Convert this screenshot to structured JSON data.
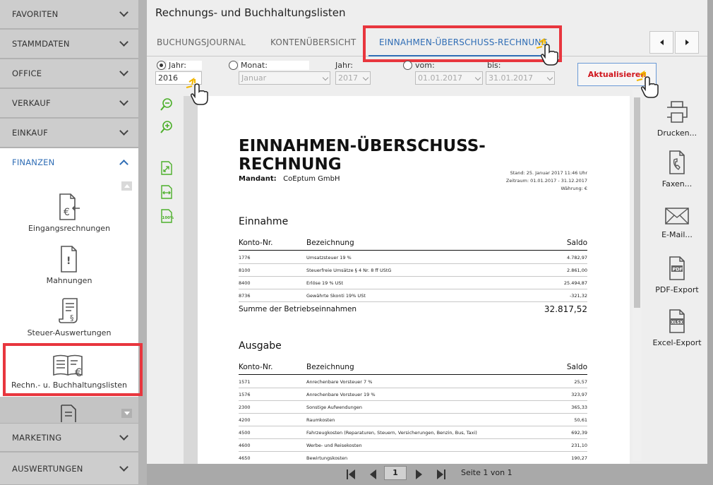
{
  "sidebar": {
    "sections": [
      {
        "label": "FAVORITEN"
      },
      {
        "label": "STAMMDATEN"
      },
      {
        "label": "OFFICE"
      },
      {
        "label": "VERKAUF"
      },
      {
        "label": "EINKAUF"
      },
      {
        "label": "FINANZEN"
      },
      {
        "label": "MARKETING"
      },
      {
        "label": "AUSWERTUNGEN"
      }
    ],
    "finance_items": [
      {
        "label": "Eingangsrechnungen",
        "icon": "incoming-invoice-icon"
      },
      {
        "label": "Mahnungen",
        "icon": "reminder-icon"
      },
      {
        "label": "Steuer-Auswertungen",
        "icon": "tax-report-icon"
      },
      {
        "label": "Rechn.- u. Buchhaltungslisten",
        "icon": "accounting-lists-icon"
      }
    ]
  },
  "main": {
    "title": "Rechnungs- und Buchhaltungslisten",
    "tabs": [
      {
        "label": "BUCHUNGSJOURNAL"
      },
      {
        "label": "KONTENÜBERSICHT"
      },
      {
        "label": "EINNAHMEN-ÜBERSCHUSS-RECHNUNG"
      }
    ],
    "active_tab": "EINNAHMEN-ÜBERSCHUSS-RECHNUNG"
  },
  "filters": {
    "jahr_label": "Jahr:",
    "jahr_value": "2016",
    "monat_label": "Monat:",
    "monat_value": "Januar",
    "monat_jahr_label": "Jahr:",
    "monat_jahr_value": "2017",
    "vom_label": "vom:",
    "vom_value": "01.01.2017",
    "bis_label": "bis:",
    "bis_value": "31.01.2017",
    "refresh_label": "Aktualisieren"
  },
  "report": {
    "title_line1": "EINNAHMEN-ÜBERSCHUSS-",
    "title_line2": "RECHNUNG",
    "mandant_label": "Mandant:",
    "mandant_value": "CoEptum GmbH",
    "stand": "Stand:  25. Januar 2017 11:46 Uhr",
    "zeitraum": "Zeitraum: 01.01.2017 - 31.12.2017",
    "waehrung": "Währung: €",
    "columns": {
      "konto": "Konto-Nr.",
      "bezeichnung": "Bezeichnung",
      "saldo": "Saldo"
    },
    "einnahme": {
      "title": "Einnahme",
      "rows": [
        {
          "konto": "1776",
          "bezeichnung": "Umsatzsteuer 19 %",
          "saldo": "4.782,97"
        },
        {
          "konto": "8100",
          "bezeichnung": "Steuerfreie Umsätze § 4 Nr. 8 ff UStG",
          "saldo": "2.861,00"
        },
        {
          "konto": "8400",
          "bezeichnung": "Erlöse 19 % USt",
          "saldo": "25.494,87"
        },
        {
          "konto": "8736",
          "bezeichnung": "Gewährte Skonti 19% USt",
          "saldo": "-321,32"
        }
      ],
      "sum_label": "Summe der Betriebseinnahmen",
      "sum_value": "32.817,52"
    },
    "ausgabe": {
      "title": "Ausgabe",
      "rows": [
        {
          "konto": "1571",
          "bezeichnung": "Anrechenbare Vorsteuer 7 %",
          "saldo": "25,57"
        },
        {
          "konto": "1576",
          "bezeichnung": "Anrechenbare Vorsteuer 19 %",
          "saldo": "323,97"
        },
        {
          "konto": "2300",
          "bezeichnung": "Sonstige Aufwendungen",
          "saldo": "365,33"
        },
        {
          "konto": "4200",
          "bezeichnung": "Raumkosten",
          "saldo": "50,61"
        },
        {
          "konto": "4500",
          "bezeichnung": "Fahrzeugkosten (Reparaturen, Steuern, Versicherungen, Benzin, Bus, Taxi)",
          "saldo": "692,39"
        },
        {
          "konto": "4600",
          "bezeichnung": "Werbe- und Reisekosten",
          "saldo": "231,10"
        },
        {
          "konto": "4650",
          "bezeichnung": "Bewirtungskosten",
          "saldo": "190,27"
        }
      ]
    }
  },
  "actions": [
    {
      "label": "Drucken...",
      "icon": "printer-icon"
    },
    {
      "label": "Faxen...",
      "icon": "fax-icon"
    },
    {
      "label": "E-Mail...",
      "icon": "email-icon"
    },
    {
      "label": "PDF-Export",
      "icon": "pdf-export-icon",
      "badge": "PDF"
    },
    {
      "label": "Excel-Export",
      "icon": "excel-export-icon",
      "badge": "XLSX"
    }
  ],
  "pager": {
    "current_page": "1",
    "page_text": "Seite 1 von 1"
  },
  "colors": {
    "accent": "#2f6db5",
    "highlight": "#e8363e",
    "toolbar_green": "#4caf2a"
  }
}
